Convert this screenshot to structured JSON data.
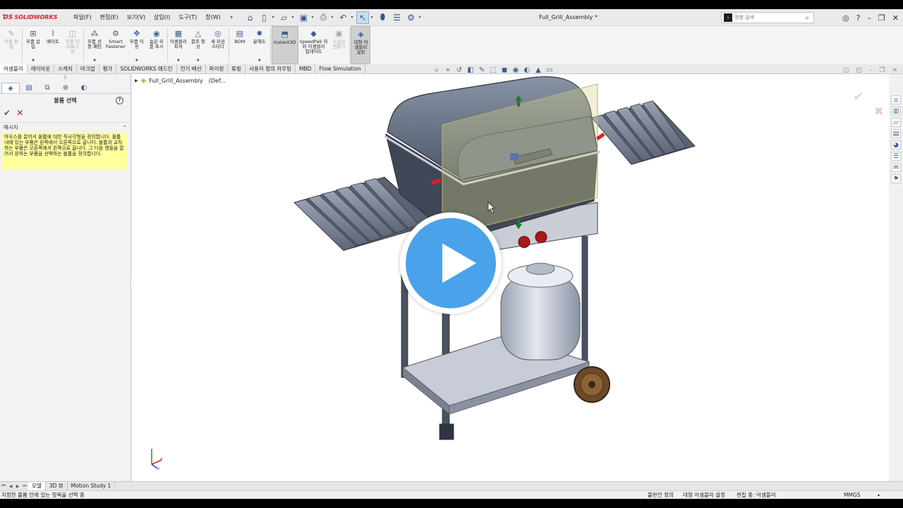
{
  "app": {
    "logo_text": "SOLIDWORKS",
    "document_title": "Full_Grill_Assembly *",
    "accent": "#d2222d"
  },
  "menu": [
    "파일(F)",
    "편집(E)",
    "보기(V)",
    "삽입(I)",
    "도구(T)",
    "창(W)"
  ],
  "search": {
    "placeholder": "명령 검색"
  },
  "ribbon": [
    {
      "label": "부품 편\n집",
      "icon": "edit-component-icon",
      "disabled": true
    },
    {
      "label": "부품 삽\n입",
      "icon": "insert-component-icon"
    },
    {
      "label": "메이트",
      "icon": "mate-icon"
    },
    {
      "label": "부품 미\n리보기\n창",
      "icon": "preview-window-icon",
      "disabled": true
    },
    {
      "label": "부품 선\n형 패턴",
      "icon": "linear-pattern-icon"
    },
    {
      "label": "Smart\nFastener",
      "icon": "smart-fastener-icon"
    },
    {
      "label": "부품 이\n동",
      "icon": "move-component-icon"
    },
    {
      "label": "숨은 부\n품 표시",
      "icon": "show-hidden-icon"
    },
    {
      "label": "어셈블리\n피처",
      "icon": "assembly-feature-icon"
    },
    {
      "label": "참조 형\n상",
      "icon": "reference-geometry-icon"
    },
    {
      "label": "새 모션\n스터디",
      "icon": "motion-study-icon"
    },
    {
      "label": "BOM",
      "icon": "bom-icon"
    },
    {
      "label": "분해도",
      "icon": "exploded-view-icon"
    },
    {
      "label": "Instant3D",
      "icon": "instant3d-icon",
      "active": true
    },
    {
      "label": "SpeedPak 하\n위 어셈블리\n업데이트",
      "icon": "speedpak-icon"
    },
    {
      "label": "스냅샷\n만들기",
      "icon": "snapshot-icon",
      "disabled": true
    },
    {
      "label": "대형 어\n셈블리\n설정",
      "icon": "large-assembly-icon",
      "active": true
    }
  ],
  "tabs": [
    "어셈블리",
    "레이아웃",
    "스케치",
    "마크업",
    "평가",
    "SOLIDWORKS 애드인",
    "전기 배선",
    "파이핑",
    "튜빙",
    "사용자 정의 라우팅",
    "MBD",
    "Flow Simulation"
  ],
  "panel": {
    "title": "볼륨 선택",
    "message_header": "메시지",
    "message": "마우스를 끌어서 볼륨에 대한 직사각형을 정의합니다. 볼륨 내에 있는 부품은 왼쪽에서 오른쪽으로 끕니다. 볼륨과 교차하는 부품은 오른쪽에서 왼쪽으로 끕니다. 그 다음 핸들을 끌어서 원하는 부품을 선택하는 볼륨을 정의합니다."
  },
  "tree": {
    "root": "Full_Grill_Assembly",
    "config": "(Def..."
  },
  "bottom_tabs": [
    "모델",
    "3D 뷰",
    "Motion Study 1"
  ],
  "status": {
    "hint": "지정한 볼륨 안에 있는 항목을 선택 중",
    "state1": "불완전 정의",
    "state2": "대형 어셈블리 설정",
    "state3": "편집 중: 어셈블리",
    "units": "MMGS"
  },
  "colors": {
    "play": "#4aa3ea",
    "grill_body": "#5d6778",
    "message_bg": "#ffff9e"
  }
}
